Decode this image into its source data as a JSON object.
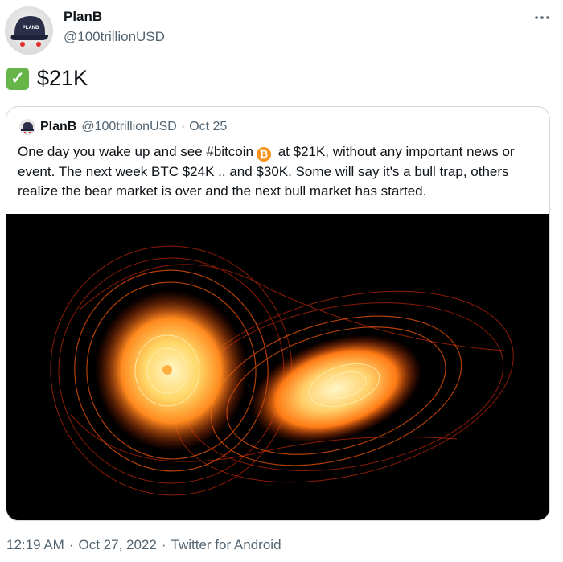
{
  "author": {
    "name": "PlanB",
    "handle": "@100trillionUSD",
    "avatar_text": "PLANB"
  },
  "tweet": {
    "check_icon": "check-mark-icon",
    "text": "$21K"
  },
  "quoted": {
    "name": "PlanB",
    "handle": "@100trillionUSD",
    "separator": "·",
    "date": "Oct 25",
    "text_part1": "One day you wake up and see #bitcoin",
    "btc_icon": "₿",
    "text_part2": " at $21K, without any important news or event. The next week BTC $24K .. and $30K. Some will say it's a bull trap, others realize the bear market is over and the next bull market has started."
  },
  "footer": {
    "time": "12:19 AM",
    "date": "Oct 27, 2022",
    "source": "Twitter for Android",
    "separator": "·"
  },
  "colors": {
    "accent_orange": "#f7931a",
    "muted": "#536471",
    "border": "#cfd9de"
  }
}
